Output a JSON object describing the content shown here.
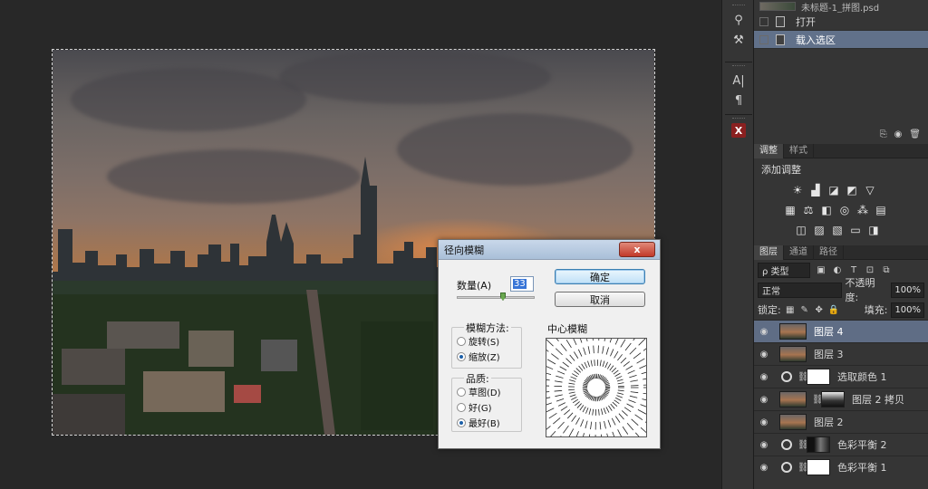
{
  "history": {
    "top_file_label": "未标题-1_拼图.psd",
    "items": [
      {
        "label": "打开",
        "active": false
      },
      {
        "label": "载入选区",
        "active": true
      }
    ]
  },
  "adjustments": {
    "tabs": [
      "调整",
      "样式"
    ],
    "active_tab": "调整",
    "title": "添加调整"
  },
  "layers_panel": {
    "tabs": [
      "图层",
      "通道",
      "路径"
    ],
    "active_tab": "图层",
    "filter_label": "ρ 类型",
    "blend_mode": "正常",
    "opacity_label": "不透明度:",
    "opacity_value": "100%",
    "lock_label": "锁定:",
    "fill_label": "填充:",
    "fill_value": "100%",
    "layers": [
      {
        "name": "图层 4",
        "type": "photo",
        "active": true
      },
      {
        "name": "图层 3",
        "type": "photo",
        "active": false
      },
      {
        "name": "选取颜色 1",
        "type": "adjust",
        "mask": "white",
        "active": false
      },
      {
        "name": "图层 2 拷贝",
        "type": "photo-mask",
        "mask": "grad",
        "active": false
      },
      {
        "name": "图层 2",
        "type": "photo",
        "active": false
      },
      {
        "name": "色彩平衡 2",
        "type": "adjust",
        "mask": "dark",
        "active": false
      },
      {
        "name": "色彩平衡 1",
        "type": "adjust",
        "mask": "white",
        "active": false
      }
    ]
  },
  "dialog": {
    "title": "径向模糊",
    "close_label": "x",
    "amount_label": "数量(A)",
    "amount_value": "33",
    "amount_fraction": 0.33,
    "ok_label": "确定",
    "cancel_label": "取消",
    "blur_method_label": "模糊方法:",
    "blur_methods": [
      {
        "label": "旋转(S)",
        "selected": false
      },
      {
        "label": "缩放(Z)",
        "selected": true
      }
    ],
    "quality_label": "品质:",
    "qualities": [
      {
        "label": "草图(D)",
        "selected": false
      },
      {
        "label": "好(G)",
        "selected": false
      },
      {
        "label": "最好(B)",
        "selected": true
      }
    ],
    "center_label": "中心模糊"
  },
  "icons": {
    "close": "close-icon",
    "eye": "eye-icon",
    "link": "link-icon"
  }
}
